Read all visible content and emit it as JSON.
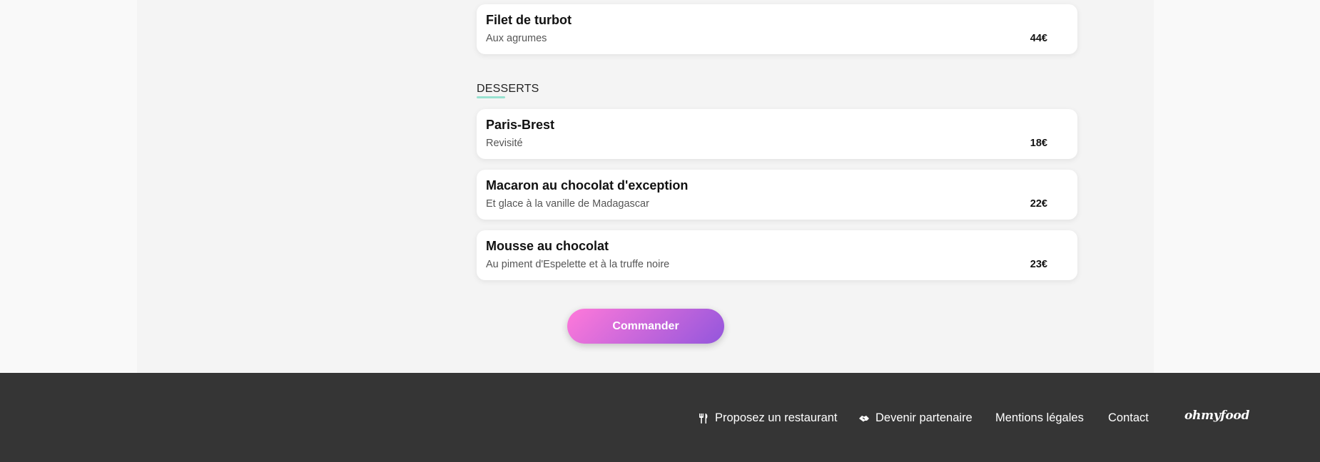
{
  "menu": {
    "main_items": [
      {
        "name": "Filet de turbot",
        "description": "Aux agrumes",
        "price": "44€"
      }
    ],
    "desserts": {
      "title": "DESSERTS",
      "items": [
        {
          "name": "Paris-Brest",
          "description": "Revisité",
          "price": "18€"
        },
        {
          "name": "Macaron au chocolat d'exception",
          "description": "Et glace à la vanille de Madagascar",
          "price": "22€"
        },
        {
          "name": "Mousse au chocolat",
          "description": "Au piment d'Espelette et à la truffe noire",
          "price": "23€"
        }
      ]
    }
  },
  "actions": {
    "order_label": "Commander"
  },
  "footer": {
    "links": [
      {
        "label": "Proposez un restaurant",
        "icon": "utensils-icon"
      },
      {
        "label": "Devenir partenaire",
        "icon": "handshake-icon"
      },
      {
        "label": "Mentions légales"
      },
      {
        "label": "Contact"
      }
    ],
    "brand": "ohmyfood"
  },
  "colors": {
    "accent_gradient_start": "#ff79da",
    "accent_gradient_end": "#9356dc",
    "section_underline": "#99e2d0",
    "footer_bg": "#353535"
  }
}
